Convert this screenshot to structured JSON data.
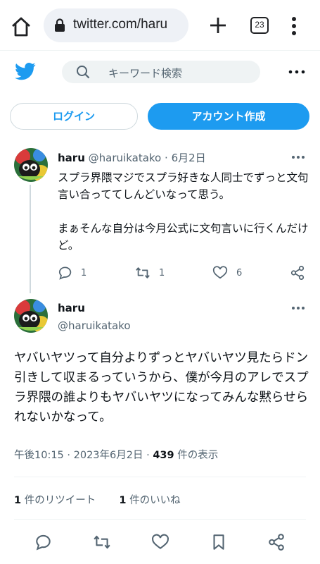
{
  "browser": {
    "url": "twitter.com/haru",
    "tab_count": "23"
  },
  "header": {
    "search_placeholder": "キーワード検索"
  },
  "auth": {
    "login_label": "ログイン",
    "signup_label": "アカウント作成"
  },
  "parent_tweet": {
    "name": "haru",
    "handle": "@haruikatako",
    "date": "6月2日",
    "text_lines": [
      "スプラ界隈マジでスプラ好きな人同士でずっと文句言い合っててしんどいなって思う。",
      "まぁそんな自分は今月公式に文句言いに行くんだけど。"
    ],
    "reply_count": "1",
    "retweet_count": "1",
    "like_count": "6"
  },
  "main_tweet": {
    "name": "haru",
    "handle": "@haruikatako",
    "text": "ヤバいヤツって自分よりずっとヤバいヤツ見たらドン引きして収まるっていうから、僕が今月のアレでスプラ界隈の誰よりもヤバいヤツになってみんな黙らせられないかなって。",
    "time": "午後10:15",
    "date": "2023年6月2日",
    "views": "439",
    "views_label": "件の表示",
    "retweets": "1",
    "retweets_label": "件のリツイート",
    "likes": "1",
    "likes_label": "件のいいね"
  },
  "colors": {
    "twitter_blue": "#1d9bf0",
    "muted_text": "#536471",
    "border": "#cfd9de"
  }
}
